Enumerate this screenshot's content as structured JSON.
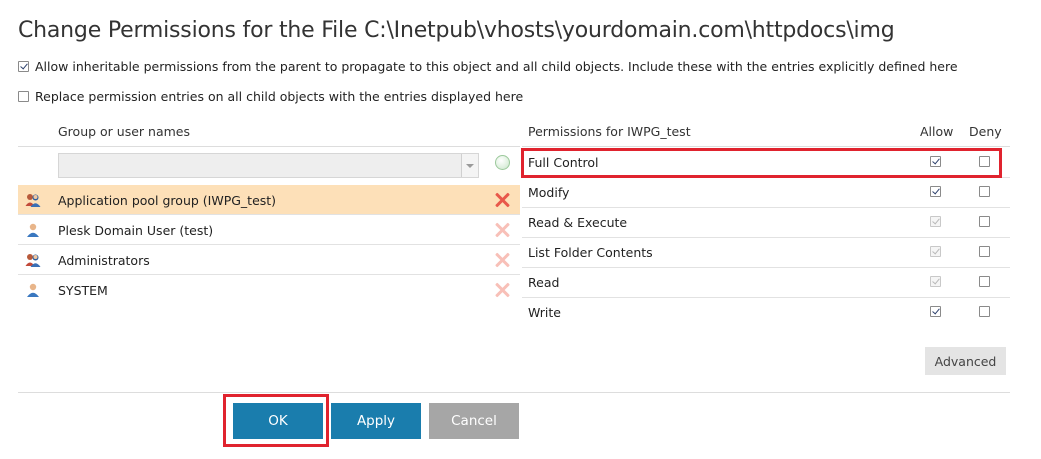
{
  "dialog": {
    "title": "Change Permissions for the File C:\\Inetpub\\vhosts\\yourdomain.com\\httpdocs\\img"
  },
  "options": [
    {
      "label": "Allow inheritable permissions from the parent to propagate to this object and all child objects. Include these with the entries explicitly defined here",
      "checked": true
    },
    {
      "label": "Replace permission entries on all child objects with the entries displayed here",
      "checked": false
    }
  ],
  "groups": {
    "header": "Group or user names",
    "combo_value": "",
    "items": [
      {
        "name": "Application pool group (IWPG_test)",
        "icon": "group-icon",
        "selected": true
      },
      {
        "name": "Plesk Domain User (test)",
        "icon": "user-icon",
        "selected": false
      },
      {
        "name": "Administrators",
        "icon": "group-icon",
        "selected": false
      },
      {
        "name": "SYSTEM",
        "icon": "user-icon",
        "selected": false
      }
    ]
  },
  "permissions": {
    "header": "Permissions for IWPG_test",
    "allow_label": "Allow",
    "deny_label": "Deny",
    "rows": [
      {
        "name": "Full Control",
        "allow": true,
        "allow_disabled": false,
        "deny": false
      },
      {
        "name": "Modify",
        "allow": true,
        "allow_disabled": false,
        "deny": false
      },
      {
        "name": "Read & Execute",
        "allow": true,
        "allow_disabled": true,
        "deny": false
      },
      {
        "name": "List Folder Contents",
        "allow": true,
        "allow_disabled": true,
        "deny": false
      },
      {
        "name": "Read",
        "allow": true,
        "allow_disabled": true,
        "deny": false
      },
      {
        "name": "Write",
        "allow": true,
        "allow_disabled": false,
        "deny": false
      }
    ],
    "advanced_label": "Advanced"
  },
  "buttons": {
    "ok": "OK",
    "apply": "Apply",
    "cancel": "Cancel"
  },
  "colors": {
    "primary": "#1a7dad",
    "selected_row": "#fde0b8",
    "highlight_red": "#e0232e"
  }
}
